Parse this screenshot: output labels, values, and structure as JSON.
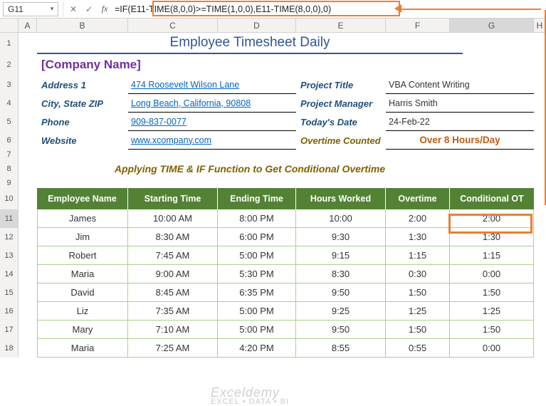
{
  "namebox": "G11",
  "formula": "=IF(E11-TIME(8,0,0)>=TIME(1,0,0),E11-TIME(8,0,0),0)",
  "columns": [
    "A",
    "B",
    "C",
    "D",
    "E",
    "F",
    "G",
    "H"
  ],
  "rows_vis": [
    "1",
    "2",
    "3",
    "4",
    "5",
    "6",
    "7",
    "8",
    "9",
    "10",
    "11",
    "12",
    "13",
    "14",
    "15",
    "16",
    "17",
    "18"
  ],
  "title": "Employee Timesheet Daily",
  "company": "[Company Name]",
  "left_labels": {
    "addr": "Address 1",
    "city": "City, State  ZIP",
    "phone": "Phone",
    "web": "Website"
  },
  "left_vals": {
    "addr": "474 Roosevelt Wilson Lane",
    "city": "Long Beach, California, 90808",
    "phone": "909-837-0077",
    "web": "www.xcompany.com"
  },
  "right_labels": {
    "ptitle": "Project Title",
    "pmgr": "Project Manager",
    "date": "Today's Date",
    "ot": "Overtime Counted"
  },
  "right_vals": {
    "ptitle": "VBA Content Writing",
    "pmgr": "Harris Smith",
    "date": "24-Feb-22",
    "ot": "Over 8 Hours/Day"
  },
  "subtitle": "Applying TIME & IF Function to Get Conditional Overtime",
  "headers": [
    "Employee Name",
    "Starting Time",
    "Ending Time",
    "Hours Worked",
    "Overtime",
    "Conditional OT"
  ],
  "tdata": [
    {
      "n": "James",
      "s": "10:00 AM",
      "e": "8:00 PM",
      "h": "10:00",
      "o": "2:00",
      "c": "2:00"
    },
    {
      "n": "Jim",
      "s": "8:30 AM",
      "e": "6:00 PM",
      "h": "9:30",
      "o": "1:30",
      "c": "1:30"
    },
    {
      "n": "Robert",
      "s": "7:45 AM",
      "e": "5:00 PM",
      "h": "9:15",
      "o": "1:15",
      "c": "1:15"
    },
    {
      "n": "Maria",
      "s": "9:00 AM",
      "e": "5:30 PM",
      "h": "8:30",
      "o": "0:30",
      "c": "0:00"
    },
    {
      "n": "David",
      "s": "8:45 AM",
      "e": "6:35 PM",
      "h": "9:50",
      "o": "1:50",
      "c": "1:50"
    },
    {
      "n": "Liz",
      "s": "7:35 AM",
      "e": "5:00 PM",
      "h": "9:25",
      "o": "1:25",
      "c": "1:25"
    },
    {
      "n": "Mary",
      "s": "7:10 AM",
      "e": "5:00 PM",
      "h": "9:50",
      "o": "1:50",
      "c": "1:50"
    },
    {
      "n": "Maria",
      "s": "7:25 AM",
      "e": "4:20 PM",
      "h": "8:55",
      "o": "0:55",
      "c": "0:00"
    }
  ],
  "icons": {
    "cancel": "✕",
    "accept": "✓",
    "fx": "fx",
    "dd": "▾"
  },
  "watermark": {
    "brand": "Exceldemy",
    "tag": "EXCEL • DATA • BI"
  }
}
